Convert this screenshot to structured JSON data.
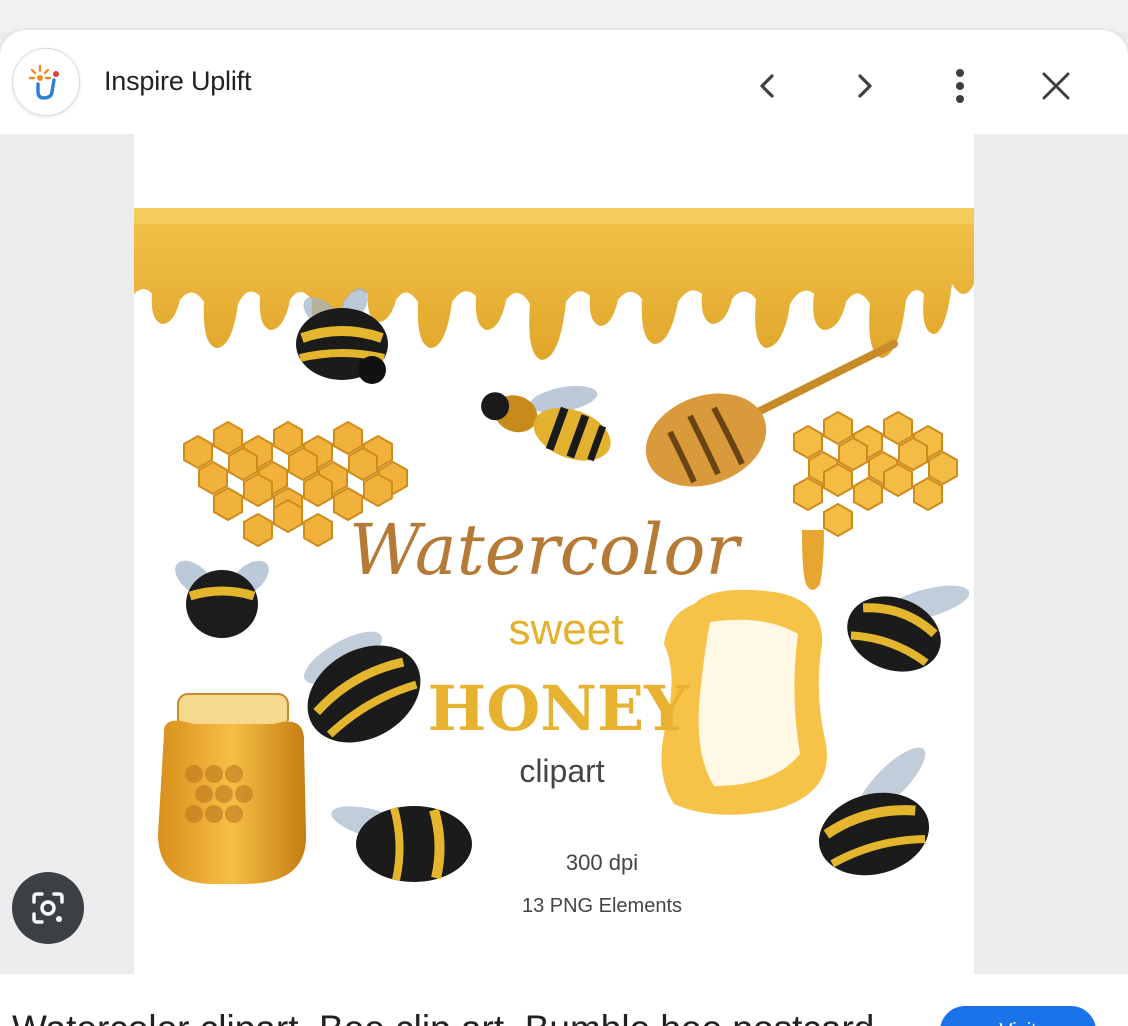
{
  "header": {
    "site_name": "Inspire Uplift",
    "icons": {
      "logo": "inspire-uplift-logo",
      "prev": "chevron-left-icon",
      "next": "chevron-right-icon",
      "more": "more-vertical-icon",
      "close": "close-icon"
    }
  },
  "artwork": {
    "title": "Watercolor",
    "subtitle": "sweet",
    "headline": "HONEY",
    "kind": "clipart",
    "resolution": "300 dpi",
    "elements": "13 PNG Elements"
  },
  "lens": {
    "icon": "lens-search-icon"
  },
  "result": {
    "caption": "Watercolor clipart, Bee clip art, Bumble bee postcard",
    "visit_label": "Visit"
  },
  "colors": {
    "honey": "#e8b433",
    "honey_dark": "#c98a1b",
    "title_brown": "#b57a36",
    "lens_bg": "#3c4043",
    "visit_blue": "#1a73e8"
  }
}
